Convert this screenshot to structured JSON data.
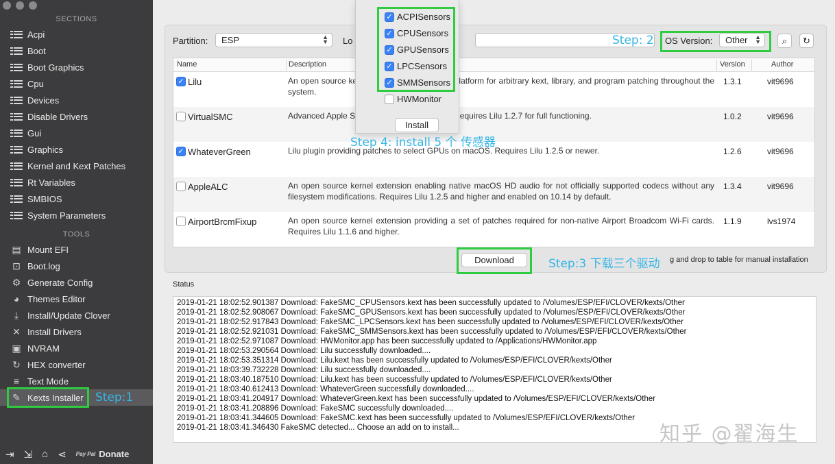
{
  "sidebar": {
    "sections_header": "SECTIONS",
    "sections": [
      {
        "label": "Acpi",
        "icon": "list-icon"
      },
      {
        "label": "Boot",
        "icon": "list-icon"
      },
      {
        "label": "Boot Graphics",
        "icon": "list-icon"
      },
      {
        "label": "Cpu",
        "icon": "list-icon"
      },
      {
        "label": "Devices",
        "icon": "list-icon"
      },
      {
        "label": "Disable Drivers",
        "icon": "list-icon"
      },
      {
        "label": "Gui",
        "icon": "list-icon"
      },
      {
        "label": "Graphics",
        "icon": "list-icon"
      },
      {
        "label": "Kernel and Kext Patches",
        "icon": "list-icon"
      },
      {
        "label": "Rt Variables",
        "icon": "list-icon"
      },
      {
        "label": "SMBIOS",
        "icon": "list-icon"
      },
      {
        "label": "System Parameters",
        "icon": "list-icon"
      }
    ],
    "tools_header": "TOOLS",
    "tools": [
      {
        "label": "Mount EFI",
        "icon": "disk-icon",
        "glyph": "▤"
      },
      {
        "label": "Boot.log",
        "icon": "log-search-icon",
        "glyph": "⊡"
      },
      {
        "label": "Generate Config",
        "icon": "gears-icon",
        "glyph": "⚙"
      },
      {
        "label": "Themes Editor",
        "icon": "palette-icon",
        "glyph": "◕"
      },
      {
        "label": "Install/Update Clover",
        "icon": "download-tray-icon",
        "glyph": "⤓"
      },
      {
        "label": "Install Drivers",
        "icon": "tools-icon",
        "glyph": "✕"
      },
      {
        "label": "NVRAM",
        "icon": "chip-icon",
        "glyph": "▣"
      },
      {
        "label": "HEX converter",
        "icon": "convert-icon",
        "glyph": "↻"
      },
      {
        "label": "Text Mode",
        "icon": "text-lines-icon",
        "glyph": "≡"
      },
      {
        "label": "Kexts Installer",
        "icon": "kext-icon",
        "glyph": "✎"
      }
    ],
    "step1": "Step:1",
    "donate": "Donate",
    "paypal": "Pay Pal"
  },
  "toolbar": {
    "partition_label": "Partition:",
    "partition_value": "ESP",
    "location_label": "Lo",
    "step2": "Step: 2",
    "os_version_label": "OS Version:",
    "os_version_value": "Other"
  },
  "table": {
    "headers": {
      "name": "Name",
      "description": "Description",
      "version": "Version",
      "author": "Author"
    },
    "rows": [
      {
        "checked": true,
        "name": "Lilu",
        "description": "An open source kernel extension providing a platform for arbitrary kext, library, and program patching throughout the system.",
        "version": "1.3.1",
        "author": "vit9696"
      },
      {
        "checked": false,
        "name": "VirtualSMC",
        "description": "Advanced Apple SMC emulator in the kernel. Requires Lilu 1.2.7 for full functioning.",
        "version": "1.0.2",
        "author": "vit9696"
      },
      {
        "checked": true,
        "name": "WhateverGreen",
        "description": "Lilu plugin providing patches to select GPUs on macOS. Requires Lilu 1.2.5 or newer.",
        "version": "1.2.6",
        "author": "vit9696"
      },
      {
        "checked": false,
        "name": "AppleALC",
        "description": "An open source kernel extension enabling native macOS HD audio for not officially supported codecs without any filesystem modifications. Requires Lilu 1.2.5 and higher and enabled on 10.14 by default.",
        "version": "1.3.4",
        "author": "vit9696"
      },
      {
        "checked": false,
        "name": "AirportBrcmFixup",
        "description": "An open source kernel extension providing a set of patches required for non-native Airport Broadcom Wi-Fi cards. Requires Lilu 1.1.6 and higher.",
        "version": "1.1.9",
        "author": "lvs1974"
      }
    ]
  },
  "download_button": "Download",
  "step3": "Step:3 下载三个驱动",
  "drag_hint": "g and drop to table for manual installation",
  "status_label": "Status",
  "status_lines": [
    "2019-01-21 18:02:52.901387 Download: FakeSMC_CPUSensors.kext has been successfully updated to /Volumes/ESP/EFI/CLOVER/kexts/Other",
    "2019-01-21 18:02:52.908067 Download: FakeSMC_GPUSensors.kext has been successfully updated to /Volumes/ESP/EFI/CLOVER/kexts/Other",
    "2019-01-21 18:02:52.917843 Download: FakeSMC_LPCSensors.kext has been successfully updated to /Volumes/ESP/EFI/CLOVER/kexts/Other",
    "2019-01-21 18:02:52.921031 Download: FakeSMC_SMMSensors.kext has been successfully updated to /Volumes/ESP/EFI/CLOVER/kexts/Other",
    "2019-01-21 18:02:52.971087 Download: HWMonitor.app has been successfully updated to /Applications/HWMonitor.app",
    "2019-01-21 18:02:53.290564 Download: Lilu successfully downloaded....",
    "2019-01-21 18:02:53.351314 Download: Lilu.kext has been successfully updated to /Volumes/ESP/EFI/CLOVER/kexts/Other",
    "2019-01-21 18:03:39.732228 Download: Lilu successfully downloaded....",
    "2019-01-21 18:03:40.187510 Download: Lilu.kext has been successfully updated to /Volumes/ESP/EFI/CLOVER/kexts/Other",
    "2019-01-21 18:03:40.612413 Download: WhateverGreen successfully downloaded....",
    "2019-01-21 18:03:41.204917 Download: WhateverGreen.kext has been successfully updated to /Volumes/ESP/EFI/CLOVER/kexts/Other",
    "2019-01-21 18:03:41.208896 Download: FakeSMC successfully downloaded....",
    "2019-01-21 18:03:41.344605 Download: FakeSMC.kext has been successfully updated to /Volumes/ESP/EFI/CLOVER/kexts/Other",
    "2019-01-21 18:03:41.346430 FakeSMC detected... Choose an add on to install..."
  ],
  "sensors_sheet": {
    "options": [
      {
        "label": "ACPISensors",
        "checked": true
      },
      {
        "label": "CPUSensors",
        "checked": true
      },
      {
        "label": "GPUSensors",
        "checked": true
      },
      {
        "label": "LPCSensors",
        "checked": true
      },
      {
        "label": "SMMSensors",
        "checked": true
      },
      {
        "label": "HWMonitor",
        "checked": false
      }
    ],
    "install_button": "Install",
    "step4": "Step 4: install 5 个 传感器"
  },
  "watermark": "知乎 @翟海生",
  "colors": {
    "annotation_green": "#2ecc40",
    "annotation_blue": "#35b6e6",
    "sidebar_bg": "#3c3c3e",
    "checkbox_blue": "#3b82f6"
  }
}
